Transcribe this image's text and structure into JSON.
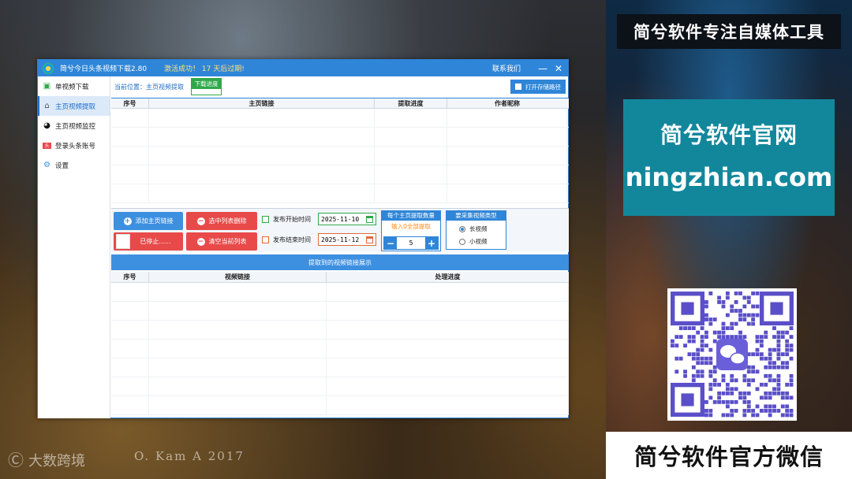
{
  "right_panel": {
    "title": "简兮软件专注自媒体工具",
    "site_label": "简兮软件官网",
    "site_url": "ningzhian.com",
    "bottom_banner": "简兮软件官方微信",
    "qr_icon": "wechat-icon"
  },
  "watermark": {
    "brand": "大数跨境",
    "credit": "O. Kam",
    "credit_suffix": "A",
    "year": "2017"
  },
  "window": {
    "title": "简兮今日头条视频下载2.80",
    "status": "激活成功！ 17 天后过期!",
    "contact": "联系我们",
    "minimize": "—",
    "close": "✕"
  },
  "sidebar": {
    "items": [
      {
        "label": "单视频下载",
        "icon": "film-icon",
        "active": false
      },
      {
        "label": "主页视频提取",
        "icon": "home-icon",
        "active": true
      },
      {
        "label": "主页视频监控",
        "icon": "clock-icon",
        "active": false
      },
      {
        "label": "登录头条账号",
        "icon": "toutiao-icon",
        "active": false
      },
      {
        "label": "设置",
        "icon": "gear-icon",
        "active": false
      }
    ]
  },
  "breadcrumb": {
    "text": "当前位置：主页视频提取",
    "download_progress": "下载进度",
    "open_storage": "打开存储路径"
  },
  "table1": {
    "columns": [
      "序号",
      "主页链接",
      "提取进度",
      "作者昵称"
    ],
    "rows": 5
  },
  "controls": {
    "add_link": "添加主页链接",
    "delete_selected": "选中列表删除",
    "stopped": "已停止......",
    "clear_list": "清空当前列表",
    "publish_start_label": "发布开始时间",
    "publish_start_value": "2025-11-10",
    "publish_end_label": "发布结束时间",
    "publish_end_value": "2025-11-12",
    "qty_header": "每个主页提取数量",
    "qty_hint": "输入0全部提取",
    "qty_value": "5",
    "qty_minus": "−",
    "qty_plus": "+",
    "vtype_header": "要采集视频类型",
    "vtype_long": "长视频",
    "vtype_short": "小视频"
  },
  "section_bar": "提取到的视频链接展示",
  "table2": {
    "columns": [
      "序号",
      "视频链接",
      "处理进度"
    ],
    "rows": 7
  }
}
